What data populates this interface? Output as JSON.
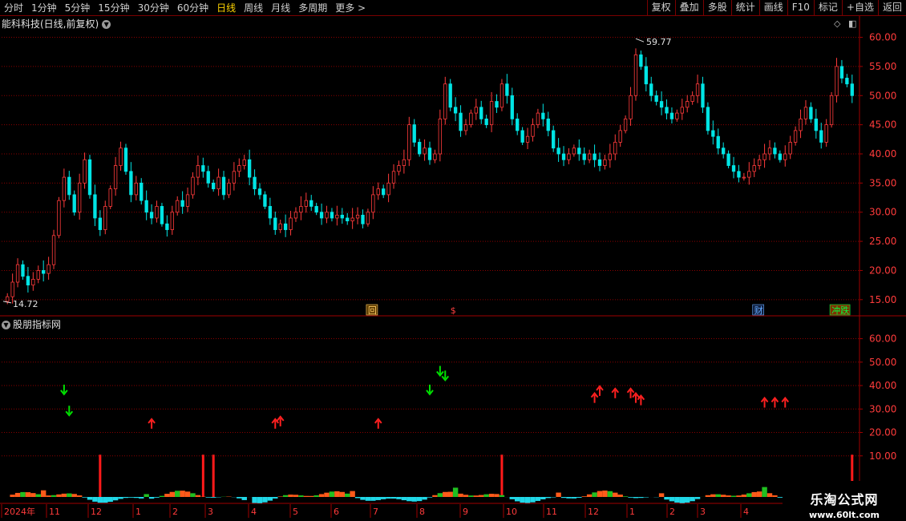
{
  "toolbar": {
    "periods": [
      "分时",
      "1分钟",
      "5分钟",
      "15分钟",
      "30分钟",
      "60分钟",
      "日线",
      "周线",
      "月线",
      "多周期",
      "更多 >"
    ],
    "active": "日线",
    "right": [
      "复权",
      "叠加",
      "多股",
      "统计",
      "画线",
      "F10",
      "标记",
      "+自选",
      "返回"
    ]
  },
  "title": {
    "stock": "能科科技(日线,前复权)"
  },
  "indicator": {
    "name": "股朋指标网"
  },
  "price_axis": [
    "60.00",
    "55.00",
    "50.00",
    "45.00",
    "40.00",
    "35.00",
    "30.00",
    "25.00",
    "20.00",
    "15.00"
  ],
  "ind_axis": [
    "60.00",
    "50.00",
    "40.00",
    "30.00",
    "20.00",
    "10.00"
  ],
  "annotations": {
    "high": "59.77",
    "low": "14.72"
  },
  "markers": [
    "回",
    "$",
    "财",
    "冲跌"
  ],
  "time_axis": [
    "2024年",
    "11",
    "12",
    "1",
    "2",
    "3",
    "4",
    "5",
    "6",
    "7",
    "8",
    "9",
    "10",
    "11",
    "12",
    "1",
    "2",
    "3",
    "4"
  ],
  "watermark": {
    "line1": "乐淘公式网",
    "line2": "www.60lt.com"
  },
  "colors": {
    "up": "#ff3b3b",
    "down": "#00e5e5",
    "grid": "#8b0000",
    "axis_text": "#ff3b3b",
    "green_arrow": "#00e000"
  },
  "chart_data": {
    "type": "candlestick",
    "price_ylim": [
      12.5,
      62
    ],
    "ind_ylim": [
      0,
      66
    ],
    "closes": [
      15.5,
      18,
      21,
      19,
      17.5,
      18.5,
      20,
      19.5,
      21,
      26,
      32,
      36,
      33,
      30,
      35,
      39,
      33,
      29,
      27,
      31,
      34,
      38,
      41,
      37,
      33,
      35,
      32,
      30,
      29,
      31,
      28,
      27,
      30,
      32,
      31,
      33,
      36,
      38,
      37,
      35,
      34,
      36,
      33,
      35,
      37,
      38,
      39,
      36,
      34,
      33,
      31,
      29,
      27,
      28,
      27,
      29,
      30,
      31,
      32,
      31,
      30,
      29,
      30,
      29,
      29.5,
      29,
      28.5,
      29,
      29.5,
      28,
      30,
      33,
      34,
      33,
      35,
      37,
      38,
      39,
      45,
      42,
      40,
      41,
      39,
      40,
      46,
      52,
      48,
      47,
      44,
      45,
      47,
      48,
      46,
      45,
      49,
      48,
      52,
      50,
      46,
      44,
      42,
      43,
      45,
      47,
      46,
      44,
      41,
      40,
      39,
      40,
      41,
      40,
      39,
      40,
      39,
      38,
      39,
      40,
      42,
      44,
      46,
      50,
      57,
      55,
      52,
      50,
      49,
      48,
      47,
      46,
      47,
      48,
      49,
      50,
      52,
      48,
      44,
      43,
      41,
      40,
      38,
      37,
      36,
      36,
      37,
      38,
      39,
      40,
      41,
      40,
      39,
      40,
      42,
      44,
      46,
      48,
      46,
      44,
      42,
      45,
      50,
      55,
      53,
      52,
      50
    ],
    "arrows": [
      {
        "i": 11,
        "v": 38,
        "dir": "down",
        "color": "green"
      },
      {
        "i": 12,
        "v": 29,
        "dir": "down",
        "color": "green"
      },
      {
        "i": 28,
        "v": 24,
        "dir": "up",
        "color": "red"
      },
      {
        "i": 52,
        "v": 24,
        "dir": "up",
        "color": "red"
      },
      {
        "i": 53,
        "v": 25,
        "dir": "up",
        "color": "red"
      },
      {
        "i": 72,
        "v": 24,
        "dir": "up",
        "color": "red"
      },
      {
        "i": 82,
        "v": 38,
        "dir": "down",
        "color": "green"
      },
      {
        "i": 84,
        "v": 46,
        "dir": "down",
        "color": "green"
      },
      {
        "i": 85,
        "v": 44,
        "dir": "down",
        "color": "green"
      },
      {
        "i": 114,
        "v": 35,
        "dir": "up",
        "color": "red"
      },
      {
        "i": 115,
        "v": 38,
        "dir": "up",
        "color": "red"
      },
      {
        "i": 118,
        "v": 37,
        "dir": "up",
        "color": "red"
      },
      {
        "i": 121,
        "v": 37,
        "dir": "up",
        "color": "red"
      },
      {
        "i": 122,
        "v": 35,
        "dir": "up",
        "color": "red"
      },
      {
        "i": 123,
        "v": 34,
        "dir": "up",
        "color": "red"
      },
      {
        "i": 147,
        "v": 33,
        "dir": "up",
        "color": "red"
      },
      {
        "i": 149,
        "v": 33,
        "dir": "up",
        "color": "red"
      },
      {
        "i": 151,
        "v": 33,
        "dir": "up",
        "color": "red"
      }
    ],
    "red_bars": [
      18,
      38,
      40,
      96,
      166
    ]
  }
}
